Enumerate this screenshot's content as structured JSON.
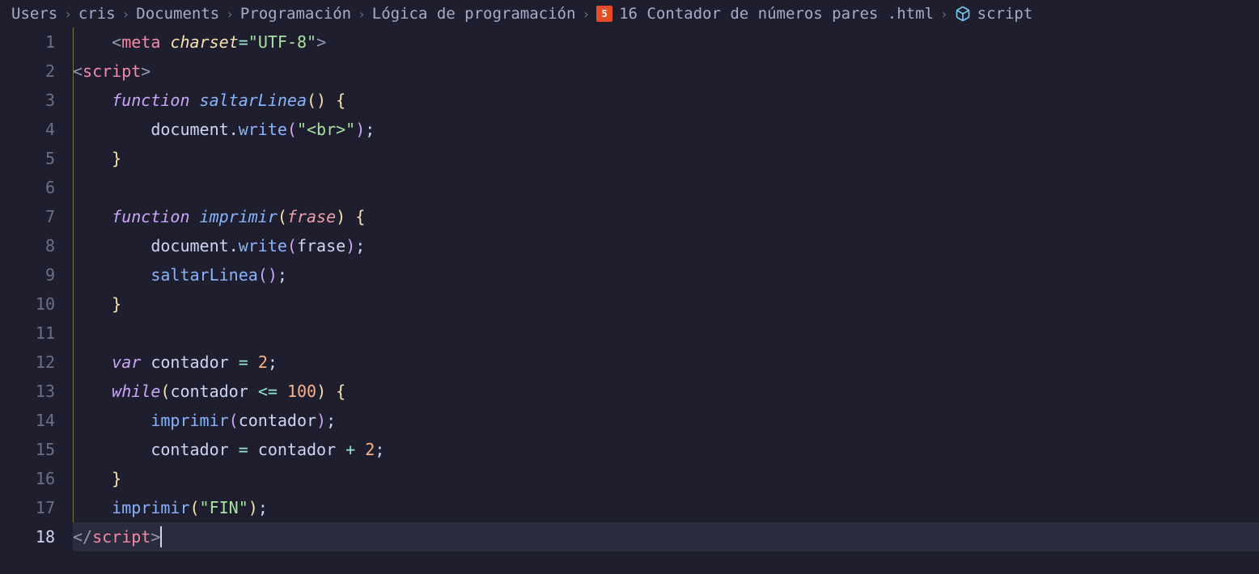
{
  "breadcrumb": {
    "items": [
      "Users",
      "cris",
      "Documents",
      "Programación",
      "Lógica de programación",
      "16 Contador de números pares .html",
      "script"
    ],
    "html_icon_label": "5"
  },
  "gutter": {
    "lines": [
      "1",
      "2",
      "3",
      "4",
      "5",
      "6",
      "7",
      "8",
      "9",
      "10",
      "11",
      "12",
      "13",
      "14",
      "15",
      "16",
      "17",
      "18"
    ],
    "active_line": 18
  },
  "code": {
    "l1_tag_open": "<",
    "l1_tag": "meta",
    "l1_attr": "charset",
    "l1_eq": "=",
    "l1_str": "\"UTF-8\"",
    "l1_close": ">",
    "l2_open": "<",
    "l2_tag": "script",
    "l2_close": ">",
    "l3_kw": "function",
    "l3_fn": "saltarLinea",
    "l3_paren_open": "(",
    "l3_paren_close": ")",
    "l3_brace": "{",
    "l4_obj": "document",
    "l4_dot": ".",
    "l4_method": "write",
    "l4_paren_open": "(",
    "l4_str": "\"<br>\"",
    "l4_paren_close": ")",
    "l4_semi": ";",
    "l5_brace": "}",
    "l7_kw": "function",
    "l7_fn": "imprimir",
    "l7_paren_open": "(",
    "l7_param": "frase",
    "l7_paren_close": ")",
    "l7_brace": "{",
    "l8_obj": "document",
    "l8_dot": ".",
    "l8_method": "write",
    "l8_paren_open": "(",
    "l8_arg": "frase",
    "l8_paren_close": ")",
    "l8_semi": ";",
    "l9_fn": "saltarLinea",
    "l9_paren_open": "(",
    "l9_paren_close": ")",
    "l9_semi": ";",
    "l10_brace": "}",
    "l12_kw": "var",
    "l12_ident": "contador",
    "l12_eq": "=",
    "l12_num": "2",
    "l12_semi": ";",
    "l13_kw": "while",
    "l13_paren_open": "(",
    "l13_ident": "contador",
    "l13_op": "<=",
    "l13_num": "100",
    "l13_paren_close": ")",
    "l13_brace": "{",
    "l14_fn": "imprimir",
    "l14_paren_open": "(",
    "l14_arg": "contador",
    "l14_paren_close": ")",
    "l14_semi": ";",
    "l15_ident": "contador",
    "l15_eq": "=",
    "l15_ident2": "contador",
    "l15_plus": "+",
    "l15_num": "2",
    "l15_semi": ";",
    "l16_brace": "}",
    "l17_fn": "imprimir",
    "l17_paren_open": "(",
    "l17_str": "\"FIN\"",
    "l17_paren_close": ")",
    "l17_semi": ";",
    "l18_open": "</",
    "l18_tag": "script",
    "l18_close": ">"
  }
}
